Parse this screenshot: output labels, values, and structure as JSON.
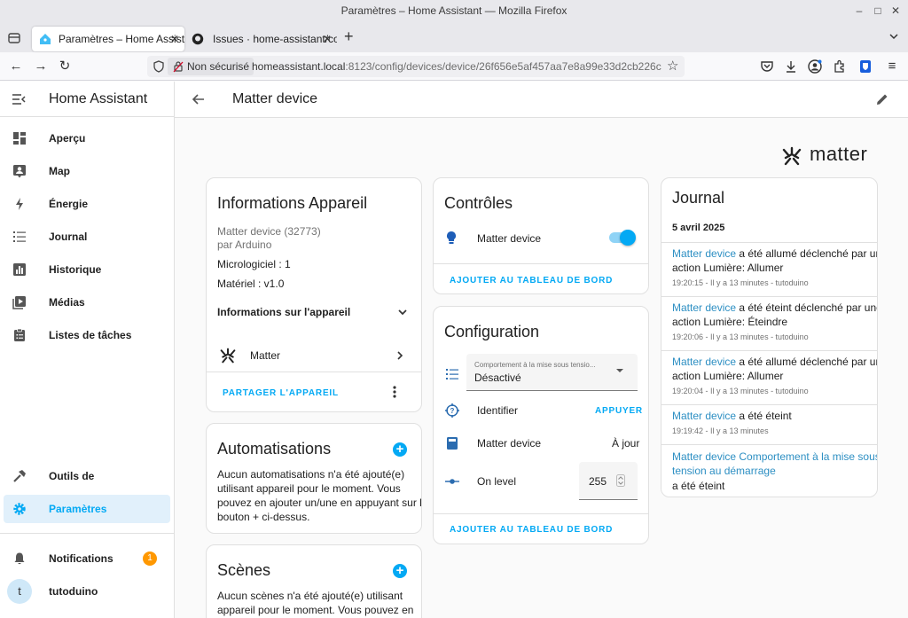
{
  "window": {
    "title": "Paramètres – Home Assistant — Mozilla Firefox"
  },
  "tabs": [
    {
      "label": "Paramètres – Home Assistant",
      "active": true
    },
    {
      "label": "Issues · home-assistant/core",
      "active": false
    }
  ],
  "url": {
    "security": "Non sécurisé",
    "host": "homeassistant.local",
    "path": ":8123/config/devices/device/26f656e5af457aa7e8a99e33d2cb226c"
  },
  "sidebar": {
    "title": "Home Assistant",
    "items": [
      {
        "label": "Aperçu",
        "icon": "view-dashboard-icon"
      },
      {
        "label": "Map",
        "icon": "account-box-icon"
      },
      {
        "label": "Énergie",
        "icon": "lightning-bolt-icon"
      },
      {
        "label": "Journal",
        "icon": "format-list-icon"
      },
      {
        "label": "Historique",
        "icon": "chart-box-icon"
      },
      {
        "label": "Médias",
        "icon": "play-box-icon"
      },
      {
        "label": "Listes de tâches",
        "icon": "clipboard-list-icon"
      }
    ],
    "bottom": [
      {
        "label": "Outils de développement",
        "icon": "hammer-icon"
      },
      {
        "label": "Paramètres",
        "icon": "cog-icon",
        "selected": true
      }
    ],
    "notifications": {
      "label": "Notifications",
      "count": "1"
    },
    "user": {
      "name": "tutoduino",
      "initial": "t"
    }
  },
  "header": {
    "title": "Matter device"
  },
  "brand": {
    "text": "matter"
  },
  "info_card": {
    "title": "Informations Appareil",
    "model": "Matter device (32773)",
    "manufacturer": "par Arduino",
    "firmware": "Micrologiciel : 1",
    "hardware": "Matériel : v1.0",
    "expander_label": "Informations sur l'appareil",
    "integration": "Matter",
    "share_label": "PARTAGER L'APPAREIL"
  },
  "automations_card": {
    "title": "Automatisations",
    "text_lines": [
      "Aucun automatisations n'a été ajouté(e)",
      "utilisant appareil pour le moment. Vous",
      "pouvez en ajouter un/une en appuyant sur le",
      "bouton + ci-dessus."
    ]
  },
  "scenes_card": {
    "title": "Scènes",
    "text_lines": [
      "Aucun scènes n'a été ajouté(e) utilisant",
      "appareil pour le moment. Vous pouvez en"
    ]
  },
  "controls_card": {
    "title": "Contrôles",
    "entity": "Matter device",
    "toggle_on": true,
    "add_label": "AJOUTER AU TABLEAU DE BORD"
  },
  "config_card": {
    "title": "Configuration",
    "select_label": "Comportement à la mise sous tensio...",
    "select_value": "Désactivé",
    "identify_label": "Identifier",
    "identify_button": "APPUYER",
    "update_label": "Matter device",
    "update_state": "À jour",
    "level_label": "On level",
    "level_value": "255",
    "add_label": "AJOUTER AU TABLEAU DE BORD"
  },
  "journal": {
    "title": "Journal",
    "date": "5 avril 2025",
    "entries": [
      {
        "link": "Matter device",
        "line1": " a été allumé déclenché par une",
        "line2": "action Lumière: Allumer",
        "meta": "19:20:15 - Il y a 13 minutes - tutoduino"
      },
      {
        "link": "Matter device",
        "line1": " a été éteint déclenché par une",
        "line2": "action Lumière: Éteindre",
        "meta": "19:20:06 - Il y a 13 minutes - tutoduino"
      },
      {
        "link": "Matter device",
        "line1": " a été allumé déclenché par une",
        "line2": "action Lumière: Allumer",
        "meta": "19:20:04 - Il y a 13 minutes - tutoduino"
      },
      {
        "link": "Matter device",
        "line1": " a été éteint",
        "line2": "",
        "meta": "19:19:42 - Il y a 13 minutes"
      },
      {
        "link": "Matter device Comportement à la mise sous",
        "link2": "tension au démarrage",
        "line1": "",
        "line2": "a été éteint",
        "meta": ""
      }
    ]
  },
  "colors": {
    "accent": "#03a9f4",
    "badge": "#ff9800",
    "link": "#2d8fc3"
  }
}
